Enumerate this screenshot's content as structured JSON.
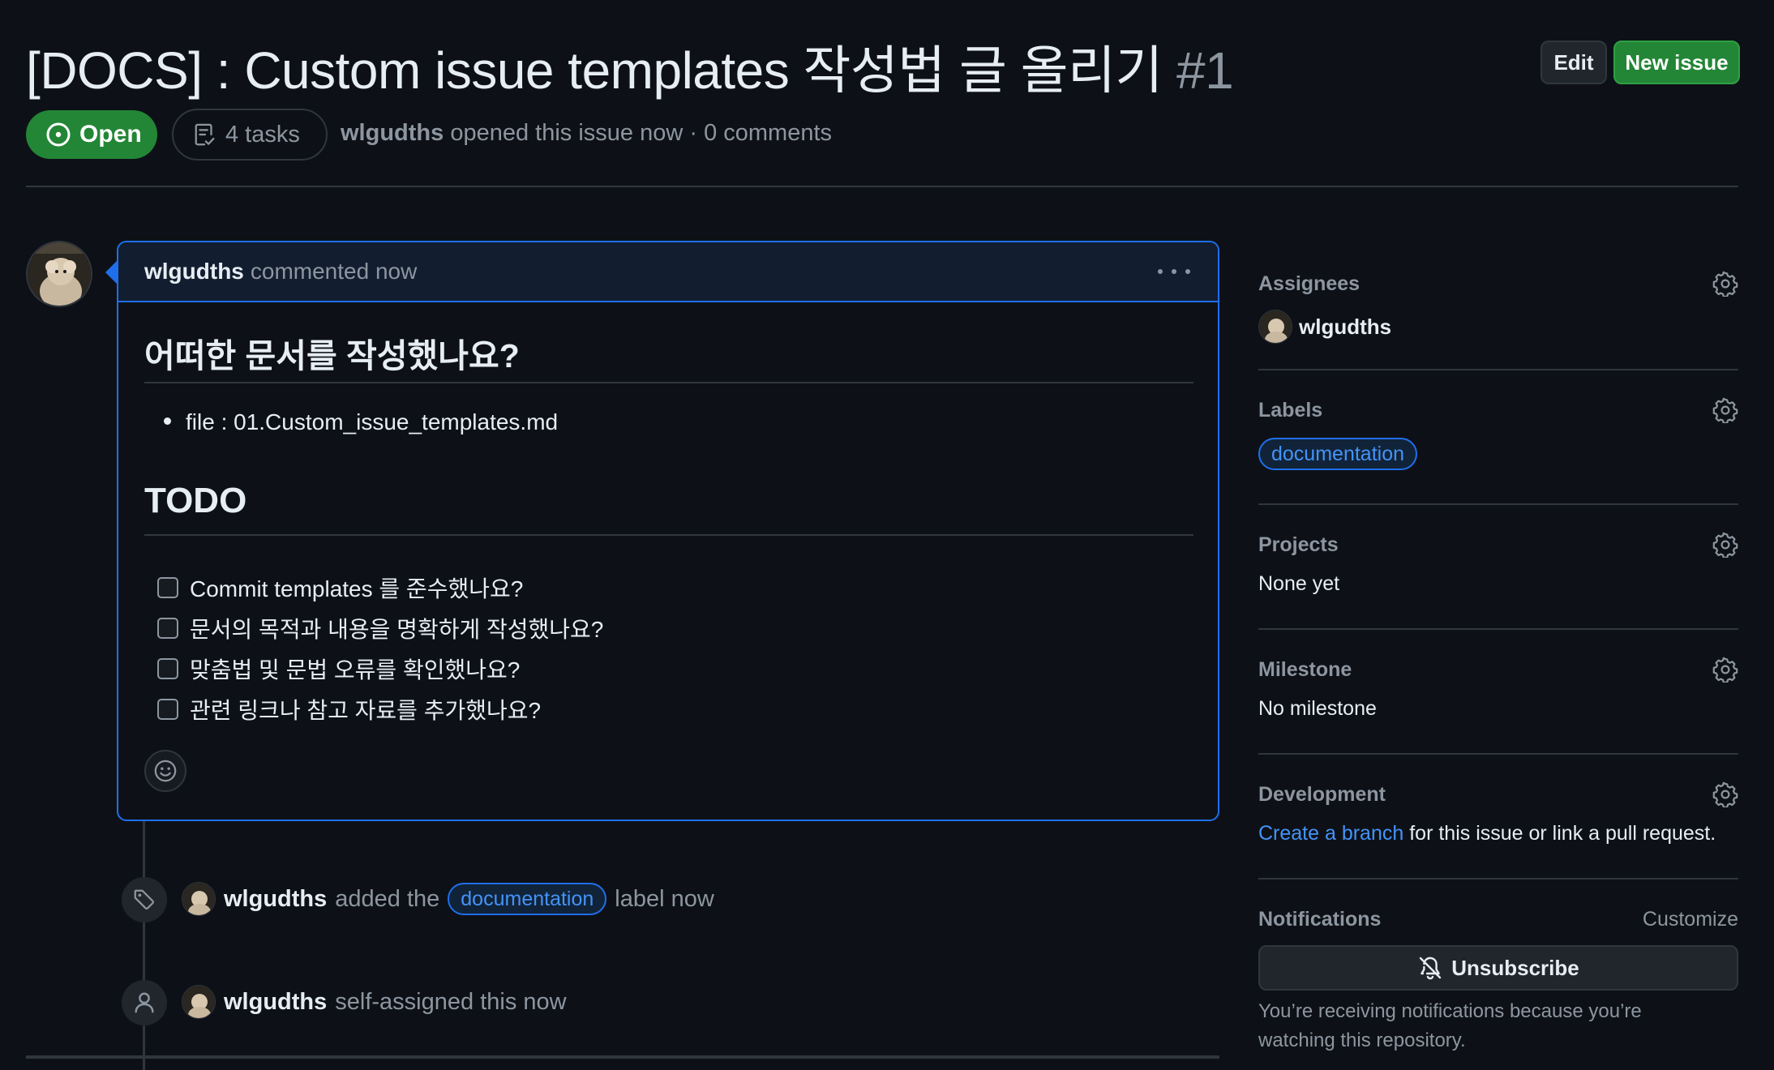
{
  "header": {
    "title": "[DOCS] : Custom issue templates 작성법 글 올리기",
    "number": "#1",
    "edit_label": "Edit",
    "new_issue_label": "New issue",
    "state_label": "Open",
    "tasks_label": "4 tasks",
    "author": "wlgudths",
    "meta_rest": " opened this issue now · 0 comments"
  },
  "colors": {
    "bg": "#0d1117",
    "open_green": "#238636",
    "accent_blue": "#1f6feb",
    "link_blue": "#4493f8",
    "muted": "#8d96a0"
  },
  "comment": {
    "author": "wlgudths",
    "time": "commented now",
    "heading": "어떠한 문서를 작성했나요?",
    "file_item": "file : 01.Custom_issue_templates.md",
    "todo_heading": "TODO",
    "tasks": [
      {
        "label": "Commit templates 를 준수했나요?",
        "checked": false
      },
      {
        "label": "문서의 목적과 내용을 명확하게 작성했나요?",
        "checked": false
      },
      {
        "label": "맞춤법 및 문법 오류를 확인했나요?",
        "checked": false
      },
      {
        "label": "관련 링크나 참고 자료를 추가했나요?",
        "checked": false
      }
    ]
  },
  "timeline": {
    "label_event": {
      "user": "wlgudths",
      "before": "added the",
      "label": "documentation",
      "after": "label now",
      "icon": "tag-icon"
    },
    "assign_event": {
      "user": "wlgudths",
      "text": "self-assigned this now",
      "icon": "person-icon"
    }
  },
  "sidebar": {
    "assignees": {
      "title": "Assignees",
      "user": "wlgudths"
    },
    "labels": {
      "title": "Labels",
      "label": "documentation"
    },
    "projects": {
      "title": "Projects",
      "value": "None yet"
    },
    "milestone": {
      "title": "Milestone",
      "value": "No milestone"
    },
    "development": {
      "title": "Development",
      "link": "Create a branch",
      "rest": " for this issue or link a pull request."
    },
    "notifications": {
      "title": "Notifications",
      "customize": "Customize",
      "button": "Unsubscribe",
      "note": "You’re receiving notifications because you’re watching this repository."
    }
  }
}
